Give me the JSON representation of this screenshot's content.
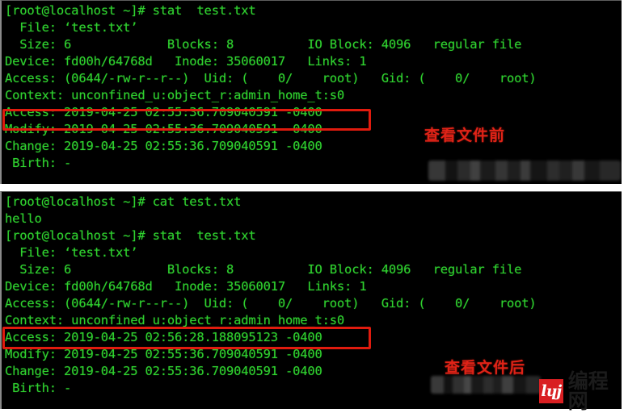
{
  "colors": {
    "terminal_background": "#000000",
    "terminal_text": "#2fd12f",
    "highlight_box": "#e01b0e",
    "annotation_text": "#e02317",
    "watermark_red": "#d91f22",
    "page_background": "#ffffff"
  },
  "terminal_before": {
    "name": "stat output before reading the file",
    "lines": [
      "[root@localhost ~]# stat  test.txt",
      "  File: ‘test.txt’",
      "  Size: 6             Blocks: 8          IO Block: 4096   regular file",
      "Device: fd00h/64768d   Inode: 35060017   Links: 1",
      "Access: (0644/-rw-r--r--)  Uid: (    0/    root)   Gid: (    0/    root)",
      "Context: unconfined_u:object_r:admin_home_t:s0",
      "Access: 2019-04-25 02:55:36.709040591 -0400",
      "Modify: 2019-04-25 02:55:36.709040591 -0400",
      "Change: 2019-04-25 02:55:36.709040591 -0400",
      " Birth: -"
    ],
    "highlighted_line_index": 6,
    "annotation": "查看文件前"
  },
  "terminal_after": {
    "name": "stat output after reading the file",
    "lines": [
      "[root@localhost ~]# cat test.txt",
      "hello",
      "[root@localhost ~]# stat  test.txt",
      "  File: ‘test.txt’",
      "  Size: 6             Blocks: 8          IO Block: 4096   regular file",
      "Device: fd00h/64768d   Inode: 35060017   Links: 1",
      "Access: (0644/-rw-r--r--)  Uid: (    0/    root)   Gid: (    0/    root)",
      "Context: unconfined_u:object_r:admin_home_t:s0",
      "Access: 2019-04-25 02:56:28.188095123 -0400",
      "Modify: 2019-04-25 02:55:36.709040591 -0400",
      "Change: 2019-04-25 02:55:36.709040591 -0400",
      " Birth: -"
    ],
    "highlighted_line_index": 8,
    "annotation": "查看文件后"
  },
  "watermark": {
    "mark_text": "lɥj",
    "wordmark": "编程网"
  },
  "redactions": {
    "before_bar_label": "blurred-redaction-bar",
    "after_bar_label": "blurred-redaction-bar"
  }
}
